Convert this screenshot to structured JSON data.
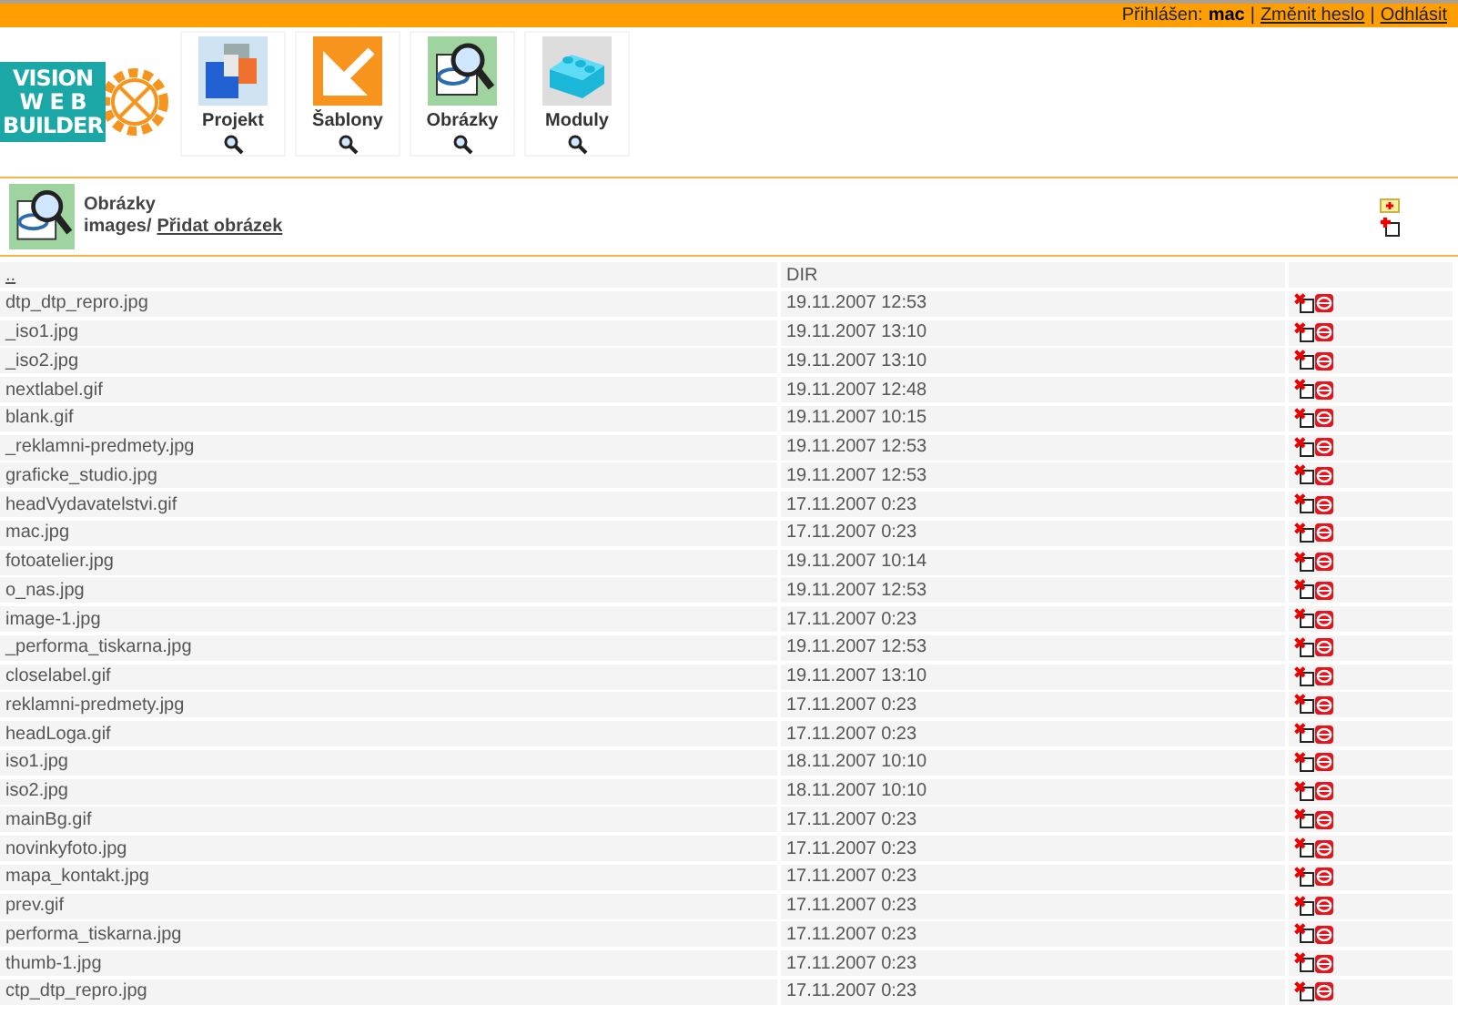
{
  "top_bar": {
    "logged_in_label": "Přihlášen:",
    "user": "mac",
    "separator": "|",
    "links": [
      "Změnit heslo",
      "Odhlásit"
    ]
  },
  "logo": {
    "lines": [
      "VISION",
      "W E B",
      "BUILDER"
    ]
  },
  "nav": [
    {
      "label": "Projekt",
      "kind": "project"
    },
    {
      "label": "Šablony",
      "kind": "templates"
    },
    {
      "label": "Obrázky",
      "kind": "images"
    },
    {
      "label": "Moduly",
      "kind": "modules"
    }
  ],
  "section": {
    "title": "Obrázky",
    "path": "images/",
    "add_link": "Přidat obrázek"
  },
  "table": {
    "header": {
      "name": "..",
      "date": "DIR"
    },
    "rows": [
      {
        "name": "dtp_dtp_repro.jpg",
        "date": "19.11.2007 12:53"
      },
      {
        "name": "_iso1.jpg",
        "date": "19.11.2007 13:10"
      },
      {
        "name": "_iso2.jpg",
        "date": "19.11.2007 13:10"
      },
      {
        "name": "nextlabel.gif",
        "date": "19.11.2007 12:48"
      },
      {
        "name": "blank.gif",
        "date": "19.11.2007 10:15"
      },
      {
        "name": "_reklamni-predmety.jpg",
        "date": "19.11.2007 12:53"
      },
      {
        "name": "graficke_studio.jpg",
        "date": "19.11.2007 12:53"
      },
      {
        "name": "headVydavatelstvi.gif",
        "date": "17.11.2007 0:23"
      },
      {
        "name": "mac.jpg",
        "date": "17.11.2007 0:23"
      },
      {
        "name": "fotoatelier.jpg",
        "date": "19.11.2007 10:14"
      },
      {
        "name": "o_nas.jpg",
        "date": "19.11.2007 12:53"
      },
      {
        "name": "image-1.jpg",
        "date": "17.11.2007 0:23"
      },
      {
        "name": "_performa_tiskarna.jpg",
        "date": "19.11.2007 12:53"
      },
      {
        "name": "closelabel.gif",
        "date": "19.11.2007 13:10"
      },
      {
        "name": "reklamni-predmety.jpg",
        "date": "17.11.2007 0:23"
      },
      {
        "name": "headLoga.gif",
        "date": "17.11.2007 0:23"
      },
      {
        "name": "iso1.jpg",
        "date": "18.11.2007 10:10"
      },
      {
        "name": "iso2.jpg",
        "date": "18.11.2007 10:10"
      },
      {
        "name": "mainBg.gif",
        "date": "17.11.2007 0:23"
      },
      {
        "name": "novinkyfoto.jpg",
        "date": "17.11.2007 0:23"
      },
      {
        "name": "mapa_kontakt.jpg",
        "date": "17.11.2007 0:23"
      },
      {
        "name": "prev.gif",
        "date": "17.11.2007 0:23"
      },
      {
        "name": "performa_tiskarna.jpg",
        "date": "17.11.2007 0:23"
      },
      {
        "name": "thumb-1.jpg",
        "date": "17.11.2007 0:23"
      },
      {
        "name": "ctp_dtp_repro.jpg",
        "date": "17.11.2007 0:23"
      }
    ]
  }
}
